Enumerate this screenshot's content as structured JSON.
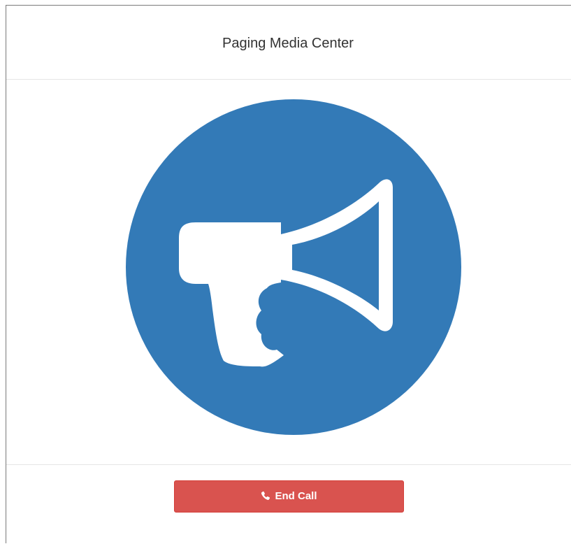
{
  "header": {
    "title": "Paging Media Center"
  },
  "main": {
    "icon": "megaphone-icon",
    "icon_circle_color": "#337ab7",
    "icon_fg_color": "#ffffff"
  },
  "footer": {
    "end_call_label": "End Call",
    "end_call_icon": "phone-icon",
    "end_call_color": "#d9534f"
  }
}
